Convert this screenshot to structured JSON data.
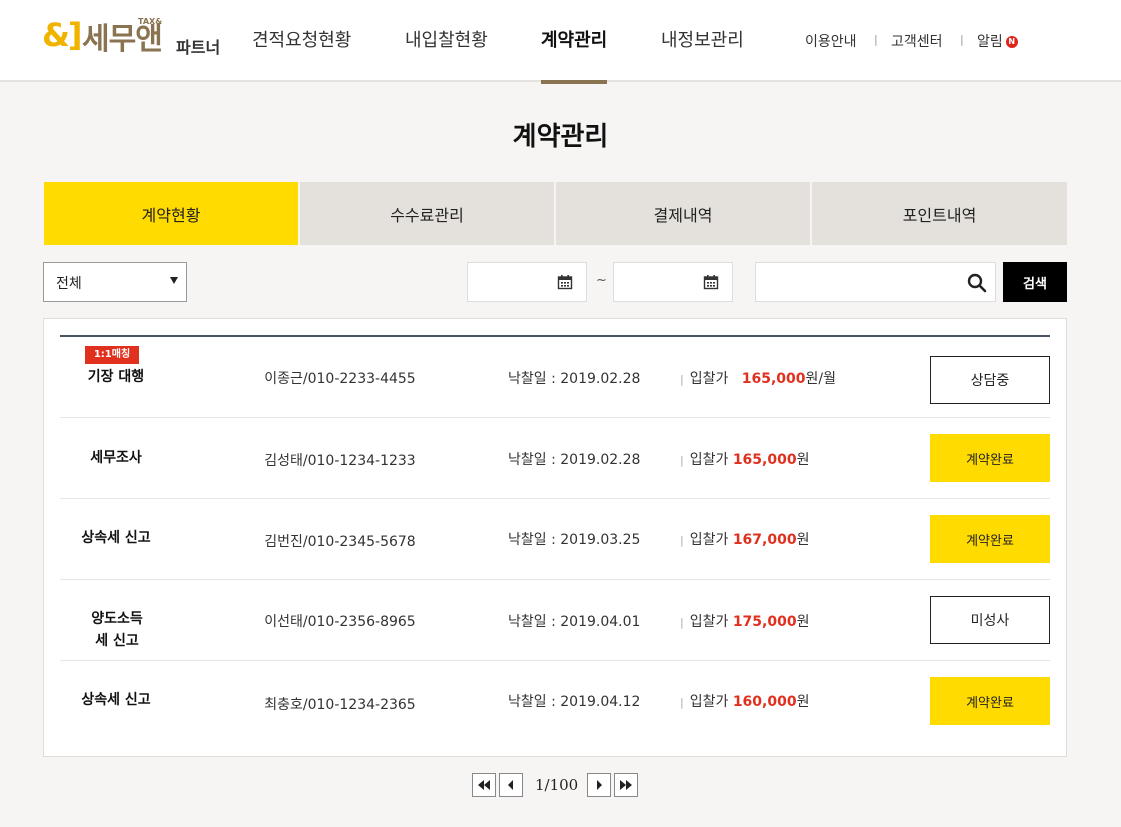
{
  "brand": {
    "amp": "&]",
    "name": "세무앤",
    "tax": "TAX&",
    "sub": "파트너",
    "color": "#f0b400"
  },
  "nav": {
    "items": [
      {
        "label": "견적요청현황",
        "active": false
      },
      {
        "label": "내입찰현황",
        "active": false
      },
      {
        "label": "계약관리",
        "active": true
      },
      {
        "label": "내정보관리",
        "active": false
      }
    ]
  },
  "util": {
    "guide": "이용안내",
    "support": "고객센터",
    "alarm": "알림",
    "alarm_badge": "N",
    "sep": "|"
  },
  "page": {
    "title": "계약관리"
  },
  "tabs": [
    {
      "label": "계약현황",
      "active": true
    },
    {
      "label": "수수료관리",
      "active": false
    },
    {
      "label": "결제내역",
      "active": false
    },
    {
      "label": "포인트내역",
      "active": false
    }
  ],
  "filters": {
    "select_value": "전체",
    "date_from": "",
    "date_to": "",
    "tilde": "~",
    "search_value": "",
    "search_button": "검색"
  },
  "contracts": [
    {
      "tag": "1:1매칭",
      "service": "기장 대행",
      "contact": "이종근/010-2233-4455",
      "date_label": "낙찰일 : 2019.02.28",
      "bid_label": "입찰가",
      "bid_amount": "165,000",
      "bid_unit": "원/월",
      "status": "상담중",
      "status_style": "outline"
    },
    {
      "tag": "",
      "service": "세무조사",
      "contact": "김성태/010-1234-1233",
      "date_label": "낙찰일 : 2019.02.28",
      "bid_label": "입찰가",
      "bid_amount": "165,000",
      "bid_unit": "원",
      "status": "계약완료",
      "status_style": "yellow"
    },
    {
      "tag": "",
      "service": "상속세 신고",
      "contact": "김번진/010-2345-5678",
      "date_label": "낙찰일 : 2019.03.25",
      "bid_label": "입찰가",
      "bid_amount": "167,000",
      "bid_unit": "원",
      "status": "계약완료",
      "status_style": "yellow"
    },
    {
      "tag": "",
      "service": "양도소득세 신고",
      "contact": "이선태/010-2356-8965",
      "date_label": "낙찰일 : 2019.04.01",
      "bid_label": "입찰가",
      "bid_amount": "175,000",
      "bid_unit": "원",
      "status": "미성사",
      "status_style": "outline"
    },
    {
      "tag": "",
      "service": "상속세 신고",
      "contact": "최충호/010-1234-2365",
      "date_label": "낙찰일 : 2019.04.12",
      "bid_label": "입찰가",
      "bid_amount": "160,000",
      "bid_unit": "원",
      "status": "계약완료",
      "status_style": "yellow"
    }
  ],
  "pagination": {
    "text": "1/100"
  },
  "colors": {
    "accent_yellow": "#ffdb00",
    "nav_underline": "#8a7350",
    "price_red": "#e0301e"
  }
}
